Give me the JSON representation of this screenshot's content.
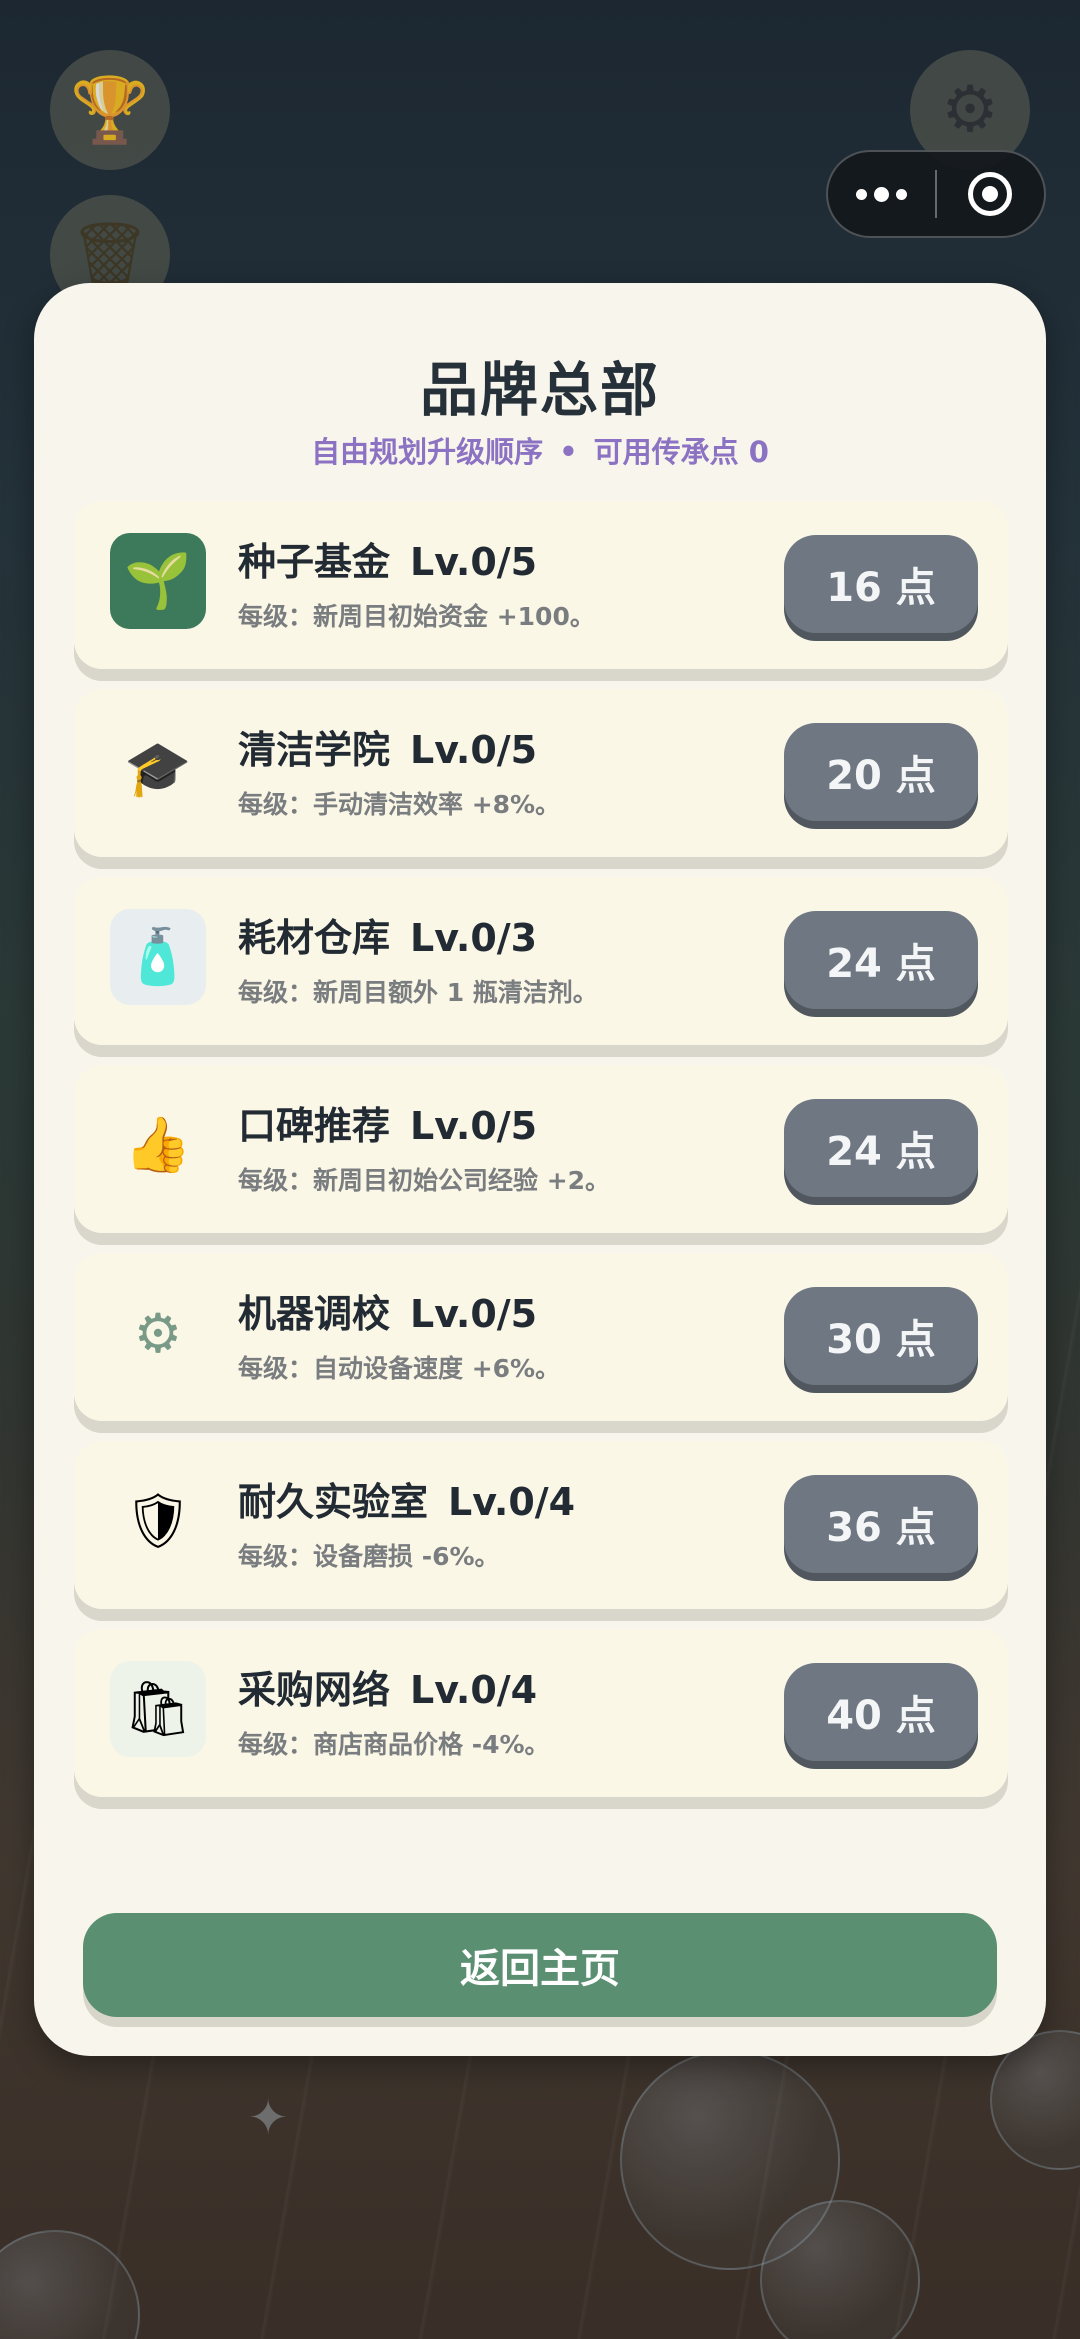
{
  "header": {
    "trophy_icon": "trophy-icon",
    "trash_icon": "trash-icon",
    "settings_icon": "gear-icon",
    "capsule": {
      "more_icon": "more-dots-icon",
      "close_icon": "target-circle-icon"
    }
  },
  "panel": {
    "title": "品牌总部",
    "subtitle_left": "自由规划升级顺序",
    "subtitle_sep": "•",
    "subtitle_right": "可用传承点 0",
    "upgrades": [
      {
        "icon": "seed-fund-icon",
        "glyph": "🌱",
        "name": "种子基金",
        "level": "Lv.0/5",
        "desc": "每级：新周目初始资金 +100。",
        "cost": "16 点",
        "bg": "#3d7a5c"
      },
      {
        "icon": "graduation-cap-mop-icon",
        "glyph": "🎓",
        "name": "清洁学院",
        "level": "Lv.0/5",
        "desc": "每级：手动清洁效率 +8%。",
        "cost": "20 点",
        "bg": "#fbf7e6"
      },
      {
        "icon": "supply-shelf-icon",
        "glyph": "🧴",
        "name": "耗材仓库",
        "level": "Lv.0/3",
        "desc": "每级：新周目额外 1 瓶清洁剂。",
        "cost": "24 点",
        "bg": "#e8eef0"
      },
      {
        "icon": "thumbs-up-stars-icon",
        "glyph": "👍",
        "name": "口碑推荐",
        "level": "Lv.0/5",
        "desc": "每级：新周目初始公司经验 +2。",
        "cost": "24 点",
        "bg": "#fbf7e6"
      },
      {
        "icon": "gear-robot-icon",
        "glyph": "⚙",
        "name": "机器调校",
        "level": "Lv.0/5",
        "desc": "每级：自动设备速度 +6%。",
        "cost": "30 点",
        "bg": "#fbf7e6"
      },
      {
        "icon": "shield-tools-icon",
        "glyph": "🛡",
        "name": "耐久实验室",
        "level": "Lv.0/4",
        "desc": "每级：设备磨损 -6%。",
        "cost": "36 点",
        "bg": "#fbf7e6"
      },
      {
        "icon": "shopping-network-icon",
        "glyph": "🛍",
        "name": "采购网络",
        "level": "Lv.0/4",
        "desc": "每级：商店商品价格 -4%。",
        "cost": "40 点",
        "bg": "#eef3ea"
      }
    ],
    "home_button": "返回主页"
  },
  "colors": {
    "panel_bg": "#f8f5ec",
    "card_bg": "#fbf7e6",
    "cost_button": "#6e7782",
    "home_button": "#5a8f71",
    "subtitle": "#8b72c2",
    "title": "#263039"
  }
}
